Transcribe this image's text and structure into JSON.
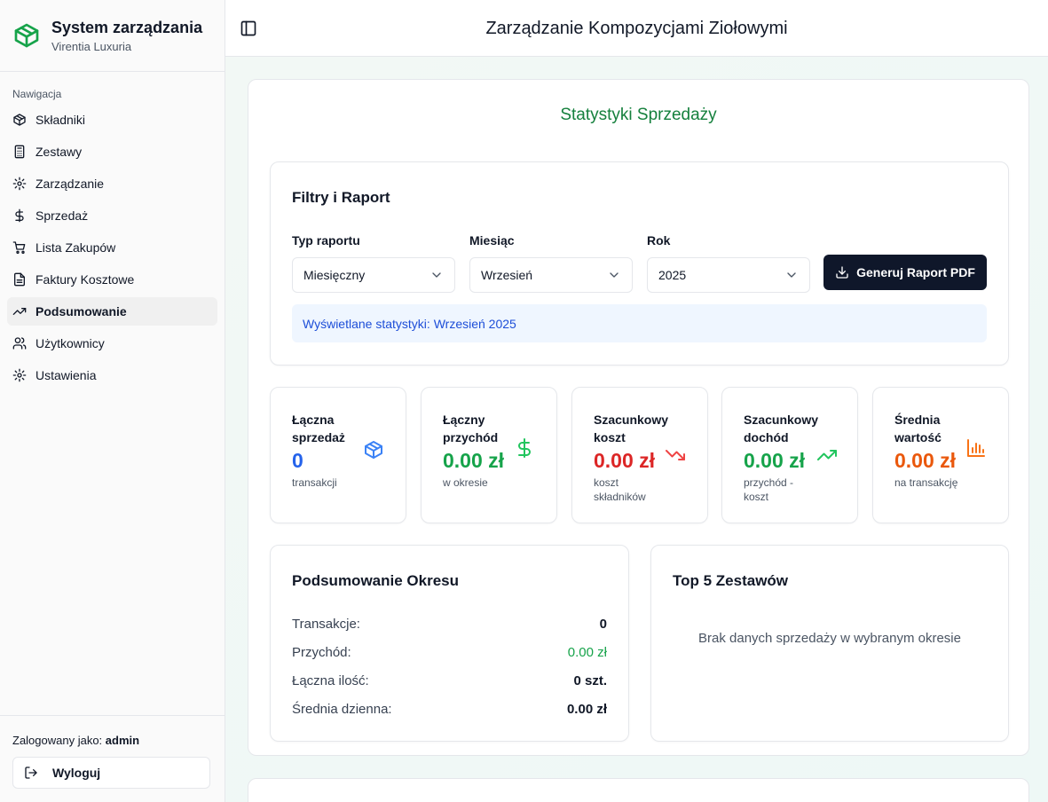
{
  "sidebar": {
    "brand_title": "System zarządzania",
    "brand_subtitle": "Virentia Luxuria",
    "nav_label": "Nawigacja",
    "items": [
      {
        "label": "Składniki",
        "icon": "package-icon"
      },
      {
        "label": "Zestawy",
        "icon": "calculator-icon"
      },
      {
        "label": "Zarządzanie",
        "icon": "gear-icon"
      },
      {
        "label": "Sprzedaż",
        "icon": "dollar-icon"
      },
      {
        "label": "Lista Zakupów",
        "icon": "cart-icon"
      },
      {
        "label": "Faktury Kosztowe",
        "icon": "file-icon"
      },
      {
        "label": "Podsumowanie",
        "icon": "trending-up-icon",
        "active": true
      },
      {
        "label": "Użytkownicy",
        "icon": "users-icon"
      },
      {
        "label": "Ustawienia",
        "icon": "gear-icon"
      }
    ],
    "logged_in_prefix": "Zalogowany jako:",
    "logged_in_user": "admin",
    "logout_label": "Wyloguj"
  },
  "header": {
    "title": "Zarządzanie Kompozycjami Ziołowymi"
  },
  "stats": {
    "title": "Statystyki Sprzedaży",
    "filters": {
      "title": "Filtry i Raport",
      "report_type_label": "Typ raportu",
      "report_type_value": "Miesięczny",
      "month_label": "Miesiąc",
      "month_value": "Wrzesień",
      "year_label": "Rok",
      "year_value": "2025",
      "generate_label": "Generuj Raport PDF",
      "info": "Wyświetlane statystyki: Wrzesień 2025"
    },
    "cards": [
      {
        "label": "Łączna sprzedaż",
        "value": "0",
        "sub": "transakcji",
        "color": "#2563eb",
        "icon": "package-icon"
      },
      {
        "label": "Łączny przychód",
        "value": "0.00 zł",
        "sub": "w okresie",
        "color": "#16a34a",
        "icon": "dollar-icon"
      },
      {
        "label": "Szacunkowy koszt",
        "value": "0.00 zł",
        "sub": "koszt składników",
        "color": "#dc2626",
        "icon": "trending-down-icon"
      },
      {
        "label": "Szacunkowy dochód",
        "value": "0.00 zł",
        "sub": "przychód - koszt",
        "color": "#16a34a",
        "icon": "trending-up-icon"
      },
      {
        "label": "Średnia wartość",
        "value": "0.00 zł",
        "sub": "na transakcję",
        "color": "#ea580c",
        "icon": "bar-chart-icon"
      }
    ],
    "summary": {
      "title": "Podsumowanie Okresu",
      "rows": [
        {
          "k": "Transakcje:",
          "v": "0"
        },
        {
          "k": "Przychód:",
          "v": "0.00 zł"
        },
        {
          "k": "Łączna ilość:",
          "v": "0 szt."
        },
        {
          "k": "Średnia dzienna:",
          "v": "0.00 zł"
        }
      ]
    },
    "top5": {
      "title": "Top 5 Zestawów",
      "empty": "Brak danych sprzedaży w wybranym okresie"
    }
  },
  "colors": {
    "brand_green": "#16a34a",
    "title_green": "#15803d",
    "primary_button": "#0f172a"
  }
}
